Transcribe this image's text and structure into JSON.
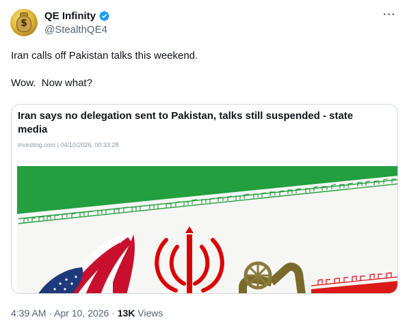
{
  "author": {
    "display_name": "QE Infinity",
    "handle": "@StealthQE4",
    "avatar_icon": "money-bag-icon",
    "verified_color": "#1d9bf0"
  },
  "tweet": {
    "text": "Iran calls off Pakistan talks this weekend.\n\nWow.  Now what?"
  },
  "card": {
    "title": "Iran says no delegation sent to Pakistan, talks still suspended - state media",
    "meta": "investing.com | 04/10/2026, 00:33:28"
  },
  "footer": {
    "time": "4:39 AM",
    "date": "Apr 10, 2026",
    "separator": "·",
    "views_count": "13K",
    "views_label": "Views"
  },
  "colors": {
    "flag_green": "#239f40",
    "flag_red": "#da0000",
    "text_secondary": "#536471"
  }
}
